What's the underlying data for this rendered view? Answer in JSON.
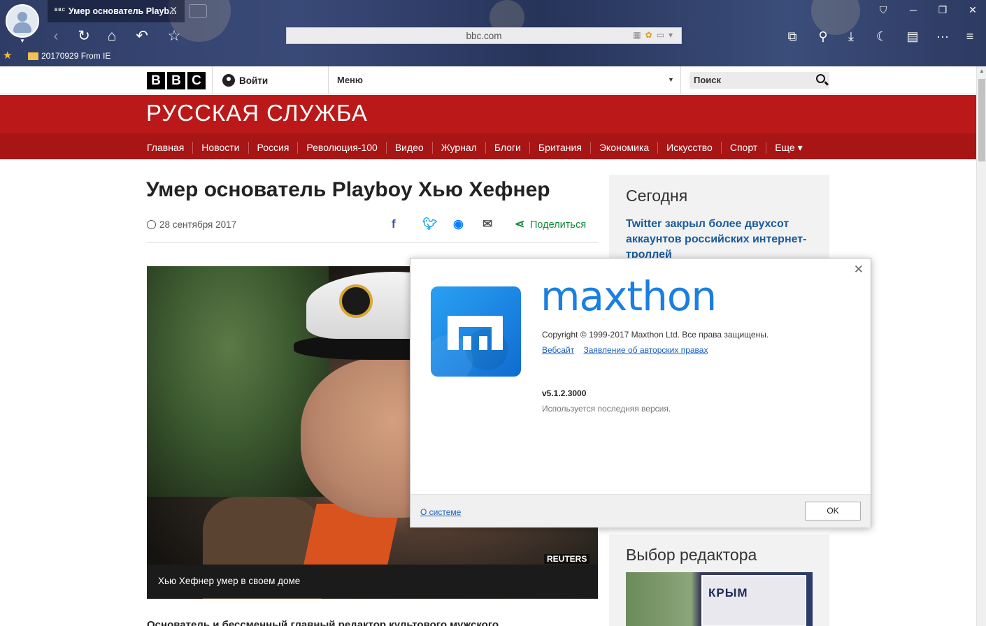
{
  "browser": {
    "tab_title": "Умер основатель Playb...",
    "tab_favicon": "BBC",
    "url": "bbc.com",
    "bookmark_folder": "20170929 From IE"
  },
  "bbc": {
    "logo_letters": [
      "B",
      "B",
      "C"
    ],
    "signin": "Войти",
    "menu": "Меню",
    "search_placeholder": "Поиск",
    "service_name": "РУССКАЯ СЛУЖБА",
    "nav": [
      "Главная",
      "Новости",
      "Россия",
      "Революция-100",
      "Видео",
      "Журнал",
      "Блоги",
      "Британия",
      "Экономика",
      "Искусство",
      "Спорт",
      "Еще ▾"
    ],
    "brand_color": "#bb1919"
  },
  "article": {
    "headline": "Умер основатель Playboy Хью Хефнер",
    "date": "28 сентября 2017",
    "share_label": "Поделиться",
    "photo_credit": "REUTERS",
    "photo_caption": "Хью Хефнер умер в своем доме",
    "body_start": "Основатель и бессменный главный редактор культового мужского"
  },
  "sidebar": {
    "today_title": "Сегодня",
    "today_link": "Twitter закрыл более двухсот аккаунтов российских интернет-троллей",
    "editors_title": "Выбор редактора",
    "editors_image_text": "КРЫМ"
  },
  "dialog": {
    "wordmark": "maxthon",
    "copyright": "Copyright © 1999-2017 Maxthon Ltd. Все права защищены.",
    "link_website": "Вебсайт",
    "link_copyright": "Заявление об авторских правах",
    "version": "v5.1.2.3000",
    "status": "Используется последняя версия.",
    "system_link": "О системе",
    "ok": "OK"
  }
}
